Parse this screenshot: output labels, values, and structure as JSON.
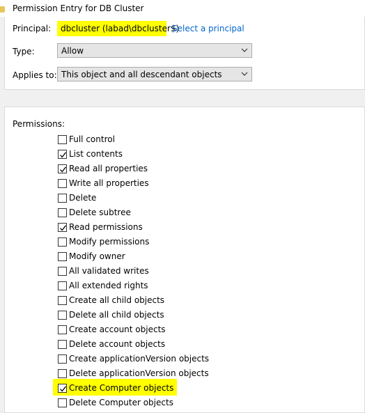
{
  "window": {
    "title": "Permission Entry for DB Cluster"
  },
  "principal": {
    "label": "Principal:",
    "value": "dbcluster (labad\\dbcluster$)",
    "select_link": "Select a principal"
  },
  "type_field": {
    "label": "Type:",
    "value": "Allow"
  },
  "applies_field": {
    "label": "Applies to:",
    "value": "This object and all descendant objects"
  },
  "permissions": {
    "label": "Permissions:",
    "items": [
      {
        "label": "Full control",
        "checked": false
      },
      {
        "label": "List contents",
        "checked": true
      },
      {
        "label": "Read all properties",
        "checked": true
      },
      {
        "label": "Write all properties",
        "checked": false
      },
      {
        "label": "Delete",
        "checked": false
      },
      {
        "label": "Delete subtree",
        "checked": false
      },
      {
        "label": "Read permissions",
        "checked": true
      },
      {
        "label": "Modify permissions",
        "checked": false
      },
      {
        "label": "Modify owner",
        "checked": false
      },
      {
        "label": "All validated writes",
        "checked": false
      },
      {
        "label": "All extended rights",
        "checked": false
      },
      {
        "label": "Create all child objects",
        "checked": false
      },
      {
        "label": "Delete all child objects",
        "checked": false
      },
      {
        "label": "Create account objects",
        "checked": false
      },
      {
        "label": "Delete account objects",
        "checked": false
      },
      {
        "label": "Create applicationVersion objects",
        "checked": false
      },
      {
        "label": "Delete applicationVersion objects",
        "checked": false
      },
      {
        "label": "Create Computer objects",
        "checked": true,
        "highlighted": true
      },
      {
        "label": "Delete Computer objects",
        "checked": false
      }
    ]
  },
  "colors": {
    "highlight": "#ffff00",
    "link": "#0066cc",
    "combo_bg": "#e5e5e5",
    "window_bg": "#f0f0f0"
  }
}
